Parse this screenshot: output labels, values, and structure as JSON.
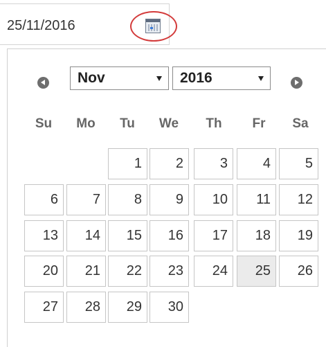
{
  "input": {
    "value": "25/11/2016",
    "icon": "calendar-icon"
  },
  "datepicker": {
    "month": "Nov",
    "year": "2016",
    "weekdays": [
      "Su",
      "Mo",
      "Tu",
      "We",
      "Th",
      "Fr",
      "Sa"
    ],
    "weeks": [
      [
        "",
        "",
        "1",
        "2",
        "3",
        "4",
        "5"
      ],
      [
        "6",
        "7",
        "8",
        "9",
        "10",
        "11",
        "12"
      ],
      [
        "13",
        "14",
        "15",
        "16",
        "17",
        "18",
        "19"
      ],
      [
        "20",
        "21",
        "22",
        "23",
        "24",
        "25",
        "26"
      ],
      [
        "27",
        "28",
        "29",
        "30",
        "",
        "",
        ""
      ]
    ],
    "selected_day": "25",
    "colors": {
      "highlight_ring": "#d33b3b",
      "selected_bg": "#ebebeb"
    }
  }
}
